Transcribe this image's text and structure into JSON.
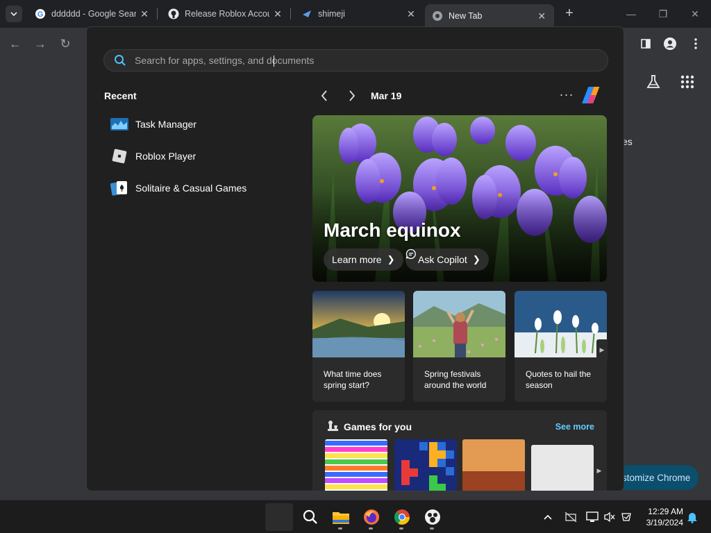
{
  "browser": {
    "tabs": [
      {
        "title": "dddddd - Google Sear",
        "favicon": "google-icon"
      },
      {
        "title": "Release Roblox Accour",
        "favicon": "github-icon"
      },
      {
        "title": "shimeji",
        "favicon": "shimeji-icon"
      },
      {
        "title": "New Tab",
        "favicon": "chrome-icon"
      }
    ],
    "ntp_fragment": "es",
    "customize_label": "stomize Chrome"
  },
  "start_menu": {
    "search": {
      "placeholder": "Search for apps, settings, and documents",
      "value": ""
    },
    "recent": {
      "title": "Recent",
      "items": [
        {
          "label": "Task Manager",
          "icon": "task-manager-icon"
        },
        {
          "label": "Roblox Player",
          "icon": "roblox-icon"
        },
        {
          "label": "Solitaire & Casual Games",
          "icon": "solitaire-icon"
        }
      ]
    },
    "widgets": {
      "date": "Mar 19",
      "hero": {
        "title": "March equinox",
        "learn_more": "Learn more",
        "ask_copilot": "Ask Copilot"
      },
      "cards": [
        {
          "caption": "What time does spring start?"
        },
        {
          "caption": "Spring festivals around the world"
        },
        {
          "caption": "Quotes to hail the season"
        }
      ],
      "games": {
        "title": "Games for you",
        "see_more": "See more"
      }
    }
  },
  "taskbar": {
    "apps": [
      "start-button",
      "search-icon",
      "file-explorer-icon",
      "firefox-icon",
      "chrome-icon",
      "shimeji-icon"
    ],
    "time": "12:29 AM",
    "date": "3/19/2024"
  },
  "colors": {
    "accent": "#60cdff",
    "menu_bg": "#202020",
    "chrome_bg": "#35363a"
  }
}
